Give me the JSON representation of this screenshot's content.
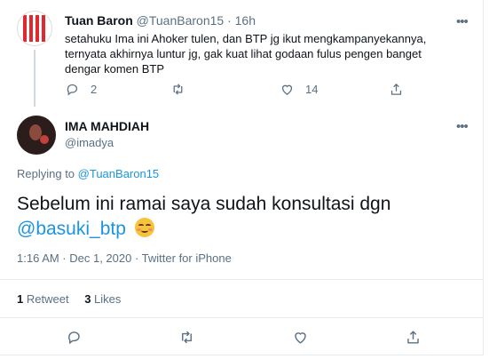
{
  "parent_tweet": {
    "name": "Tuan Baron",
    "handle": "@TuanBaron15",
    "separator": "·",
    "time": "16h",
    "text": "setahuku Ima ini Ahoker tulen, dan BTP jg ikut mengkampanyekannya, ternyata akhirnya luntur jg, gak kuat lihat godaan fulus pengen banget dengar komen BTP",
    "replies": "2",
    "likes": "14",
    "icons": [
      "more-icon",
      "reply-icon",
      "retweet-icon",
      "like-icon",
      "share-icon"
    ]
  },
  "main_tweet": {
    "name": "IMA MAHDIAH",
    "handle": "@imadya",
    "replying_prefix": "Replying to",
    "replying_to": "@TuanBaron15",
    "text": "Sebelum ini ramai saya sudah konsultasi dgn",
    "mention": "@basuki_btp",
    "emoji": "smiling-face-with-smiling-eyes",
    "timestamp": "1:16 AM · Dec 1, 2020 · Twitter for iPhone",
    "retweets_count": "1",
    "retweets_label": "Retweet",
    "likes_count": "3",
    "likes_label": "Likes",
    "icons": [
      "more-icon",
      "reply-icon",
      "retweet-icon",
      "like-icon",
      "share-icon"
    ]
  },
  "colors": {
    "text": "#0f1419",
    "secondary": "#5b7083",
    "link": "#1b95e0",
    "divider": "#e6ecf0"
  }
}
